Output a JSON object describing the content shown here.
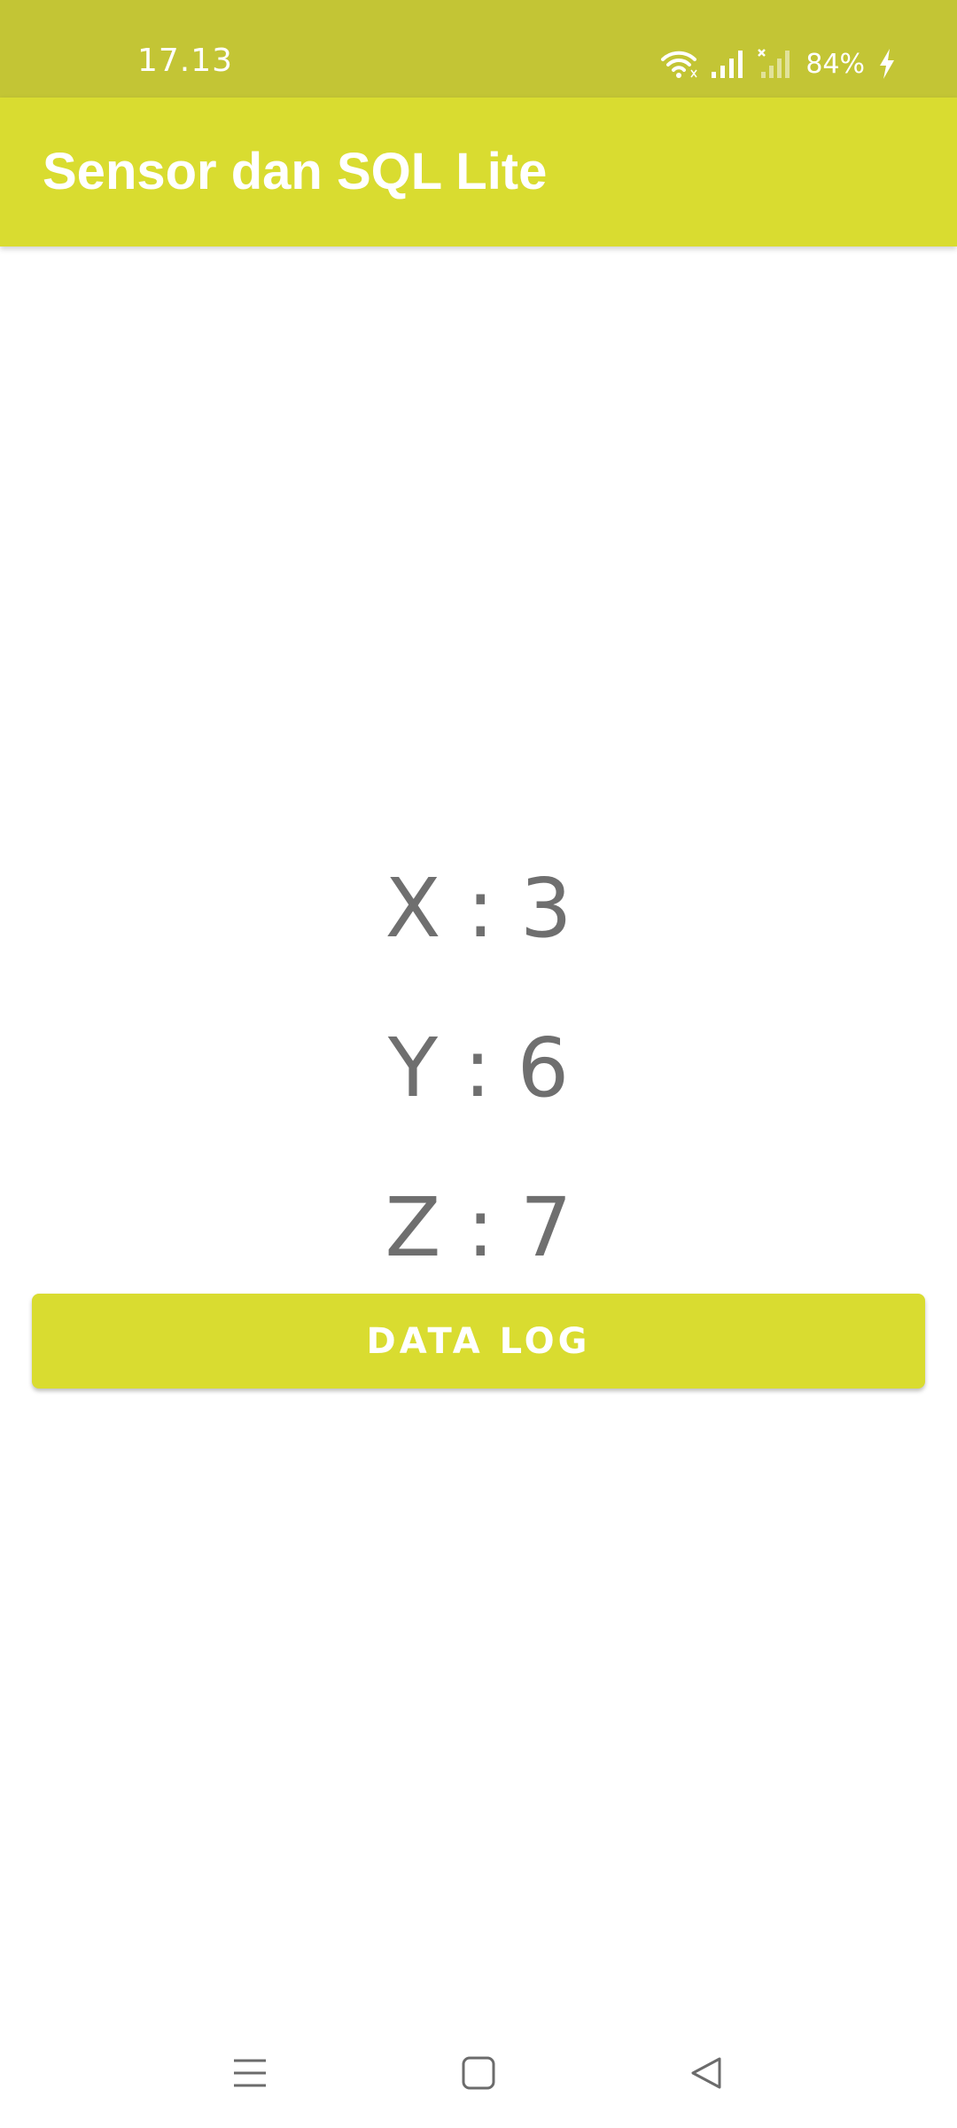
{
  "status_bar": {
    "time": "17.13",
    "battery": "84%",
    "icons": [
      "wifi-icon",
      "signal-icon",
      "no-signal-icon",
      "charging-icon"
    ]
  },
  "app_bar": {
    "title": "Sensor dan SQL Lite"
  },
  "readings": {
    "x": "X : 3",
    "y": "Y : 6",
    "z": "Z : 7"
  },
  "button": {
    "data_log_label": "DATA LOG"
  },
  "nav_bar": {
    "icons": [
      "menu-icon",
      "home-icon",
      "back-icon"
    ]
  },
  "colors": {
    "status_bar": "#c3c535",
    "accent": "#d9dc30",
    "reading_text": "#6f6f6f"
  }
}
